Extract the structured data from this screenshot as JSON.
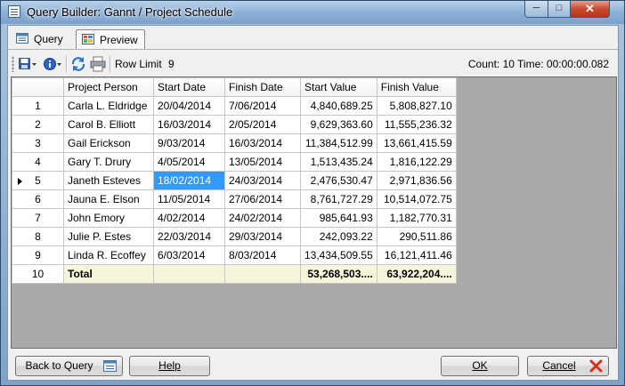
{
  "window": {
    "title": "Query Builder:  Gannt / Project Schedule",
    "min_glyph": "─",
    "max_glyph": "□",
    "close_glyph": "✕"
  },
  "tabs": [
    {
      "label": "Query"
    },
    {
      "label": "Preview"
    }
  ],
  "toolbar": {
    "row_limit_label": "Row Limit",
    "row_limit_value": "9",
    "count_text": "Count: 10  Time: 00:00:00.082"
  },
  "grid": {
    "columns": [
      "Project Person",
      "Start Date",
      "Finish Date",
      "Start Value",
      "Finish Value"
    ],
    "rows": [
      [
        "1",
        "Carla L. Eldridge",
        "20/04/2014",
        "7/06/2014",
        "4,840,689.25",
        "5,808,827.10"
      ],
      [
        "2",
        "Carol B. Elliott",
        "16/03/2014",
        "2/05/2014",
        "9,629,363.60",
        "11,555,236.32"
      ],
      [
        "3",
        "Gail Erickson",
        "9/03/2014",
        "16/03/2014",
        "11,384,512.99",
        "13,661,415.59"
      ],
      [
        "4",
        "Gary T. Drury",
        "4/05/2014",
        "13/05/2014",
        "1,513,435.24",
        "1,816,122.29"
      ],
      [
        "5",
        "Janeth Esteves",
        "18/02/2014",
        "24/03/2014",
        "2,476,530.47",
        "2,971,836.56"
      ],
      [
        "6",
        "Jauna E. Elson",
        "11/05/2014",
        "27/06/2014",
        "8,761,727.29",
        "10,514,072.75"
      ],
      [
        "7",
        "John Emory",
        "4/02/2014",
        "24/02/2014",
        "985,641.93",
        "1,182,770.31"
      ],
      [
        "8",
        "Julie P. Estes",
        "22/03/2014",
        "29/03/2014",
        "242,093.22",
        "290,511.86"
      ],
      [
        "9",
        "Linda R. Ecoffey",
        "6/03/2014",
        "8/03/2014",
        "13,434,509.55",
        "16,121,411.46"
      ]
    ],
    "total_row": [
      "10",
      "Total",
      "",
      "",
      "53,268,503....",
      "63,922,204...."
    ],
    "selected": {
      "row": 5,
      "column": "Start Date"
    }
  },
  "buttons": {
    "back": "Back to Query",
    "help": "Help",
    "ok": "OK",
    "cancel": "Cancel"
  },
  "colors": {
    "selection": "#3399ff",
    "total_row_bg": "#f6f6dc",
    "grid_background": "#aaaaaa",
    "close_button": "#c74a2e"
  }
}
